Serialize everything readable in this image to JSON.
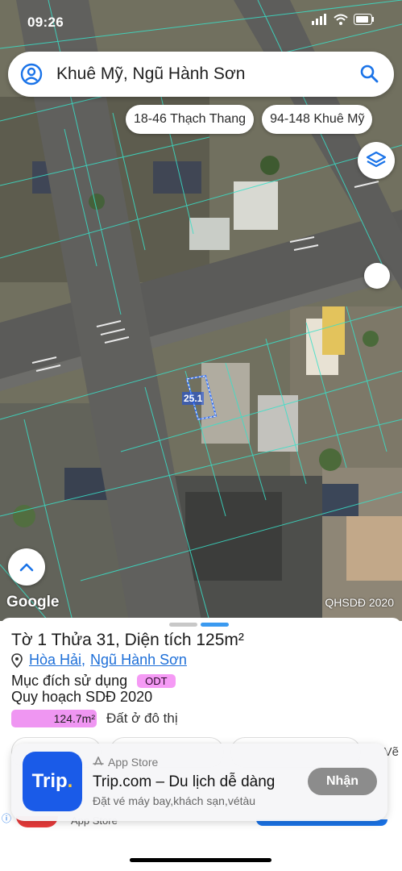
{
  "status_bar": {
    "time": "09:26"
  },
  "search": {
    "query": "Khuê Mỹ, Ngũ Hành Sơn"
  },
  "chips": [
    {
      "label": "18-46 Thạch Thang"
    },
    {
      "label": "94-148 Khuê Mỹ"
    }
  ],
  "map": {
    "attribution": "Google",
    "overlay_label": "QHSDĐ 2020",
    "parcel_number_label": "25.1"
  },
  "parcel": {
    "title": "Tờ 1 Thửa 31, Diện tích 125m²",
    "ward": "Hòa Hải",
    "district": "Ngũ Hành Sơn",
    "purpose_label": "Mục đích sử dụng",
    "purpose_code": "ODT",
    "planning_label": "Quy hoạch SDĐ 2020",
    "planning_area": "124.7m²",
    "planning_area_fraction": 1.0,
    "planning_desc": "Đất ở đô thị",
    "peek_tab": "Vẽ"
  },
  "ad": {
    "store": "App Store",
    "app_name": "Trip.com – Du lịch dễ dàng",
    "description": "Đặt vé máy bay,khách sạn,vétàu",
    "button": "Nhận",
    "icon_text": "Trip",
    "icon_dot": "."
  },
  "under_ad": {
    "store": "App Store"
  },
  "colors": {
    "accent_blue": "#1e6fd8",
    "odt_pink": "#f59af5",
    "ad_button": "#8c8c8c",
    "trip_blue": "#1a5be8"
  }
}
